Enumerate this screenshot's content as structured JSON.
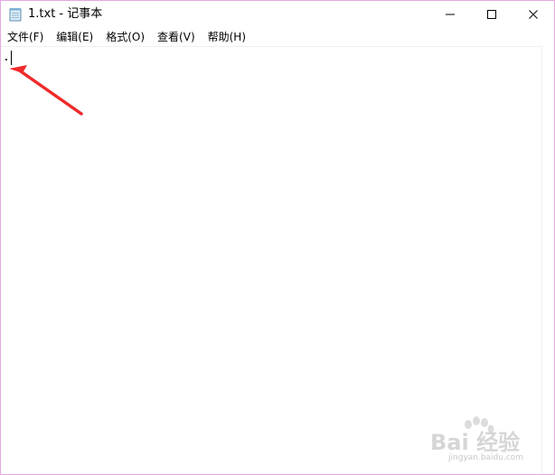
{
  "window": {
    "title": "1.txt - 记事本"
  },
  "menu": {
    "items": [
      {
        "label": "文件(F)"
      },
      {
        "label": "编辑(E)"
      },
      {
        "label": "格式(O)"
      },
      {
        "label": "查看(V)"
      },
      {
        "label": "帮助(H)"
      }
    ]
  },
  "editor": {
    "content": "."
  },
  "watermark": {
    "brand": "Bai 经验",
    "url": "jingyan.baidu.com"
  },
  "colors": {
    "annotation_arrow": "#f02a2a",
    "window_border": "#e6a8e0"
  },
  "icons": {
    "app": "notepad-icon",
    "minimize": "minimize-icon",
    "maximize": "maximize-icon",
    "close": "close-icon",
    "annotation": "red-arrow-icon"
  }
}
